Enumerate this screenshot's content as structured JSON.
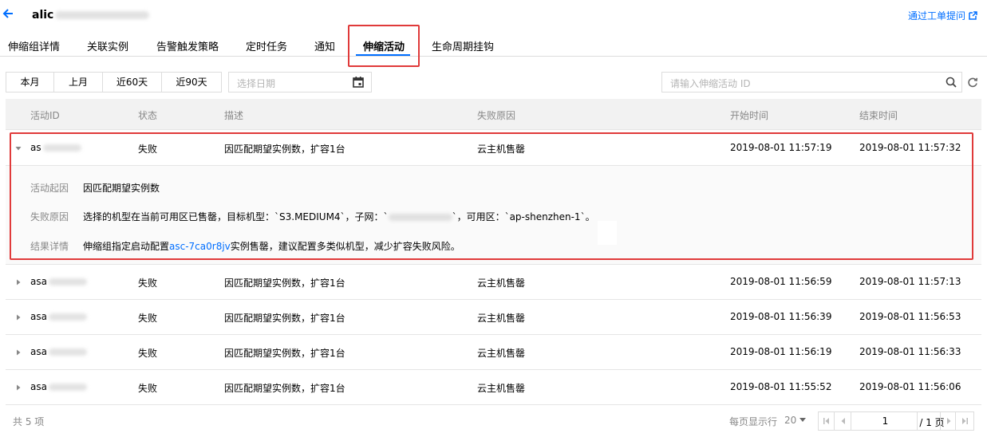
{
  "header": {
    "title": "alic",
    "ticket_link": "通过工单提问"
  },
  "tabs": [
    {
      "label": "伸缩组详情"
    },
    {
      "label": "关联实例"
    },
    {
      "label": "告警触发策略"
    },
    {
      "label": "定时任务"
    },
    {
      "label": "通知"
    },
    {
      "label": "伸缩活动"
    },
    {
      "label": "生命周期挂钩"
    }
  ],
  "filters": {
    "date_buttons": [
      "本月",
      "上月",
      "近60天",
      "近90天"
    ],
    "date_placeholder": "选择日期",
    "search_placeholder": "请输入伸缩活动 ID"
  },
  "table": {
    "columns": [
      "活动ID",
      "状态",
      "描述",
      "失败原因",
      "开始时间",
      "结束时间"
    ],
    "rows": [
      {
        "id": "as",
        "status": "失败",
        "desc": "因匹配期望实例数，扩容1台",
        "reason": "云主机售罄",
        "start": "2019-08-01 11:57:19",
        "end": "2019-08-01 11:57:32"
      },
      {
        "id": "asa",
        "status": "失败",
        "desc": "因匹配期望实例数，扩容1台",
        "reason": "云主机售罄",
        "start": "2019-08-01 11:56:59",
        "end": "2019-08-01 11:57:13"
      },
      {
        "id": "asa",
        "status": "失败",
        "desc": "因匹配期望实例数，扩容1台",
        "reason": "云主机售罄",
        "start": "2019-08-01 11:56:39",
        "end": "2019-08-01 11:56:53"
      },
      {
        "id": "asa",
        "status": "失败",
        "desc": "因匹配期望实例数，扩容1台",
        "reason": "云主机售罄",
        "start": "2019-08-01 11:56:19",
        "end": "2019-08-01 11:56:33"
      },
      {
        "id": "asa",
        "status": "失败",
        "desc": "因匹配期望实例数，扩容1台",
        "reason": "云主机售罄",
        "start": "2019-08-01 11:55:52",
        "end": "2019-08-01 11:56:06"
      }
    ],
    "detail": {
      "cause_label": "活动起因",
      "cause_value": "因匹配期望实例数",
      "reason_label": "失败原因",
      "reason_value_a": "选择的机型在当前可用区已售罄，目标机型：`S3.MEDIUM4`，子网：`",
      "reason_value_b": "`，可用区：`ap-shenzhen-1`。",
      "result_label": "结果详情",
      "result_value_a": "伸缩组指定启动配置",
      "result_link": "asc-7ca0r8jv",
      "result_value_b": "实例售罄，建议配置多类似机型，减少扩容失败风险。"
    }
  },
  "footer": {
    "total": "共 5 项",
    "page_size_label": "每页显示行",
    "page_size": "20",
    "current_page": "1",
    "total_pages": "/ 1 页"
  }
}
